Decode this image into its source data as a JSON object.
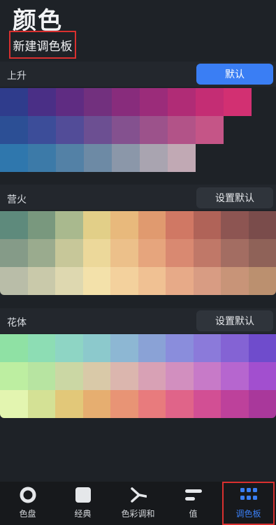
{
  "header": {
    "title": "颜色",
    "new_palette_label": "新建调色板"
  },
  "sections": [
    {
      "name": "上升",
      "button": "默认",
      "rows": [
        [
          "#2f3c8c",
          "#4a2f86",
          "#5f2c82",
          "#72307e",
          "#882c7c",
          "#9b2c7a",
          "#b02c76",
          "#c42d74",
          "#d23072"
        ],
        [
          "#2c4f95",
          "#3c4d99",
          "#524c98",
          "#6c4f92",
          "#84518f",
          "#9c528b",
          "#b25388",
          "#c55587"
        ],
        [
          "#2f77ad",
          "#3c7aa8",
          "#5381a6",
          "#6d8aa5",
          "#8b97a9",
          "#a9a4b0",
          "#c1a9b4"
        ]
      ]
    },
    {
      "name": "营火",
      "button": "设置默认",
      "rows": [
        [
          "#5e8a7c",
          "#79987e",
          "#a9b98e",
          "#e2cf88",
          "#e8b97c",
          "#e09a6f",
          "#d07864",
          "#b06358",
          "#8d5552",
          "#7a4c4b"
        ],
        [
          "#859b88",
          "#9aab8e",
          "#c7c799",
          "#ecd89a",
          "#ecc08a",
          "#e6a57d",
          "#d98971",
          "#c07868",
          "#a36d62",
          "#8f6258"
        ],
        [
          "#b9bda8",
          "#c9c9aa",
          "#ded8b0",
          "#f3e1aa",
          "#f3d19d",
          "#f0c193",
          "#e7aa88",
          "#d89c83",
          "#c89478",
          "#bb906f"
        ]
      ]
    },
    {
      "name": "花体",
      "button": "设置默认",
      "rows": [
        [
          "#8fe1a4",
          "#8dddb4",
          "#8ed5c4",
          "#8cc9cc",
          "#8db7d3",
          "#8aa2d6",
          "#8a8ddc",
          "#8b7ada",
          "#8463d4",
          "#6f4ccc"
        ],
        [
          "#bdeea1",
          "#b7e4a1",
          "#cbd7a4",
          "#d9c9a8",
          "#dbb6ae",
          "#d8a1b5",
          "#d28fbf",
          "#c77ac8",
          "#b666cf",
          "#a24fcf"
        ],
        [
          "#e3f5b0",
          "#d4e195",
          "#e2c879",
          "#e6ae70",
          "#e89475",
          "#e87b7d",
          "#e06489",
          "#d24f94",
          "#bd419b",
          "#a9389b"
        ]
      ]
    }
  ],
  "tabs": [
    {
      "label": "色盘",
      "icon": "ring-icon"
    },
    {
      "label": "经典",
      "icon": "square-icon"
    },
    {
      "label": "色彩调和",
      "icon": "harmony-icon"
    },
    {
      "label": "值",
      "icon": "bars-icon"
    },
    {
      "label": "调色板",
      "icon": "grid-icon",
      "active": true
    }
  ],
  "colors": {
    "accent": "#3a7ef4",
    "highlight": "#d9302f"
  }
}
